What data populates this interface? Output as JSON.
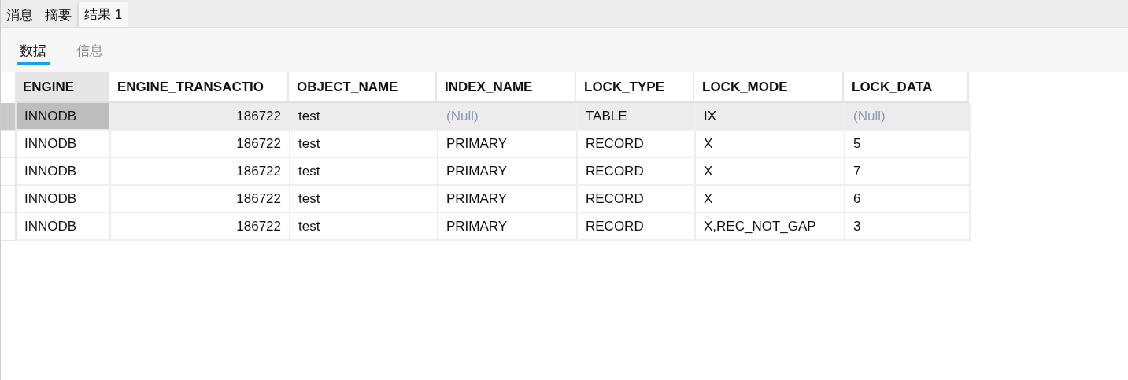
{
  "tabs": [
    {
      "label": "消息",
      "selected": false
    },
    {
      "label": "摘要",
      "selected": false
    },
    {
      "label": "结果 1",
      "selected": true
    }
  ],
  "sub_tabs": [
    {
      "label": "数据",
      "selected": true
    },
    {
      "label": "信息",
      "selected": false
    }
  ],
  "table": {
    "columns": [
      {
        "label": "ENGINE",
        "kind": "text"
      },
      {
        "label": "ENGINE_TRANSACTIO",
        "kind": "number"
      },
      {
        "label": "OBJECT_NAME",
        "kind": "text"
      },
      {
        "label": "INDEX_NAME",
        "kind": "text"
      },
      {
        "label": "LOCK_TYPE",
        "kind": "text"
      },
      {
        "label": "LOCK_MODE",
        "kind": "text"
      },
      {
        "label": "LOCK_DATA",
        "kind": "text"
      }
    ],
    "rows": [
      {
        "selected": true,
        "cells": [
          {
            "text": "INNODB",
            "kind": "value",
            "focused": true
          },
          {
            "text": "186722",
            "kind": "value",
            "focused": false
          },
          {
            "text": "test",
            "kind": "value",
            "focused": false
          },
          {
            "text": "(Null)",
            "kind": "null",
            "focused": false
          },
          {
            "text": "TABLE",
            "kind": "value",
            "focused": false
          },
          {
            "text": "IX",
            "kind": "value",
            "focused": false
          },
          {
            "text": "(Null)",
            "kind": "null",
            "focused": false
          }
        ]
      },
      {
        "selected": false,
        "cells": [
          {
            "text": "INNODB",
            "kind": "value",
            "focused": false
          },
          {
            "text": "186722",
            "kind": "value",
            "focused": false
          },
          {
            "text": "test",
            "kind": "value",
            "focused": false
          },
          {
            "text": "PRIMARY",
            "kind": "value",
            "focused": false
          },
          {
            "text": "RECORD",
            "kind": "value",
            "focused": false
          },
          {
            "text": "X",
            "kind": "value",
            "focused": false
          },
          {
            "text": "5",
            "kind": "value",
            "focused": false
          }
        ]
      },
      {
        "selected": false,
        "cells": [
          {
            "text": "INNODB",
            "kind": "value",
            "focused": false
          },
          {
            "text": "186722",
            "kind": "value",
            "focused": false
          },
          {
            "text": "test",
            "kind": "value",
            "focused": false
          },
          {
            "text": "PRIMARY",
            "kind": "value",
            "focused": false
          },
          {
            "text": "RECORD",
            "kind": "value",
            "focused": false
          },
          {
            "text": "X",
            "kind": "value",
            "focused": false
          },
          {
            "text": "7",
            "kind": "value",
            "focused": false
          }
        ]
      },
      {
        "selected": false,
        "cells": [
          {
            "text": "INNODB",
            "kind": "value",
            "focused": false
          },
          {
            "text": "186722",
            "kind": "value",
            "focused": false
          },
          {
            "text": "test",
            "kind": "value",
            "focused": false
          },
          {
            "text": "PRIMARY",
            "kind": "value",
            "focused": false
          },
          {
            "text": "RECORD",
            "kind": "value",
            "focused": false
          },
          {
            "text": "X",
            "kind": "value",
            "focused": false
          },
          {
            "text": "6",
            "kind": "value",
            "focused": false
          }
        ]
      },
      {
        "selected": false,
        "cells": [
          {
            "text": "INNODB",
            "kind": "value",
            "focused": false
          },
          {
            "text": "186722",
            "kind": "value",
            "focused": false
          },
          {
            "text": "test",
            "kind": "value",
            "focused": false
          },
          {
            "text": "PRIMARY",
            "kind": "value",
            "focused": false
          },
          {
            "text": "RECORD",
            "kind": "value",
            "focused": false
          },
          {
            "text": "X,REC_NOT_GAP",
            "kind": "value",
            "focused": false
          },
          {
            "text": "3",
            "kind": "value",
            "focused": false
          }
        ]
      }
    ]
  }
}
